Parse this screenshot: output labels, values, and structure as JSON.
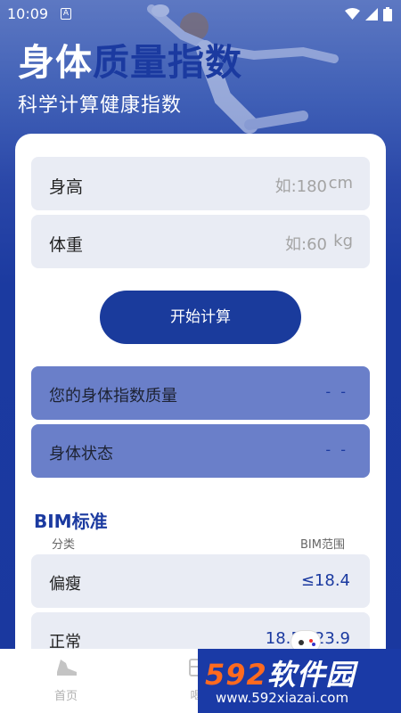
{
  "status": {
    "time": "10:09",
    "notification_letter": "A"
  },
  "header": {
    "title_part1": "身体",
    "title_part2": "质量指数",
    "subtitle": "科学计算健康指数"
  },
  "form": {
    "height": {
      "label": "身高",
      "placeholder": "如:180",
      "unit": "cm"
    },
    "weight": {
      "label": "体重",
      "placeholder": "如:60",
      "unit": "kg"
    },
    "calculate_label": "开始计算"
  },
  "results": {
    "bmi": {
      "label": "您的身体指数质量",
      "value": "- -"
    },
    "state": {
      "label": "身体状态",
      "value": "- -"
    }
  },
  "standard": {
    "title": "BIM标准",
    "col_category": "分类",
    "col_range": "BIM范围",
    "rows": [
      {
        "name": "偏瘦",
        "range": "≤18.4"
      },
      {
        "name": "正常",
        "range": "18.5~23.9"
      }
    ]
  },
  "tabs": [
    {
      "label": "首页",
      "icon": "shoe-icon",
      "active": true
    },
    {
      "label": "喝",
      "icon": "cup-icon",
      "active": false
    }
  ],
  "watermark": {
    "num": "592",
    "brand": "软件园",
    "url": "www.592xiazai.com"
  },
  "colors": {
    "accent": "#1b3aa0",
    "result_bg": "#6a7fc9",
    "field_bg": "#e9ecf4",
    "watermark_num": "#ff6a1f"
  }
}
